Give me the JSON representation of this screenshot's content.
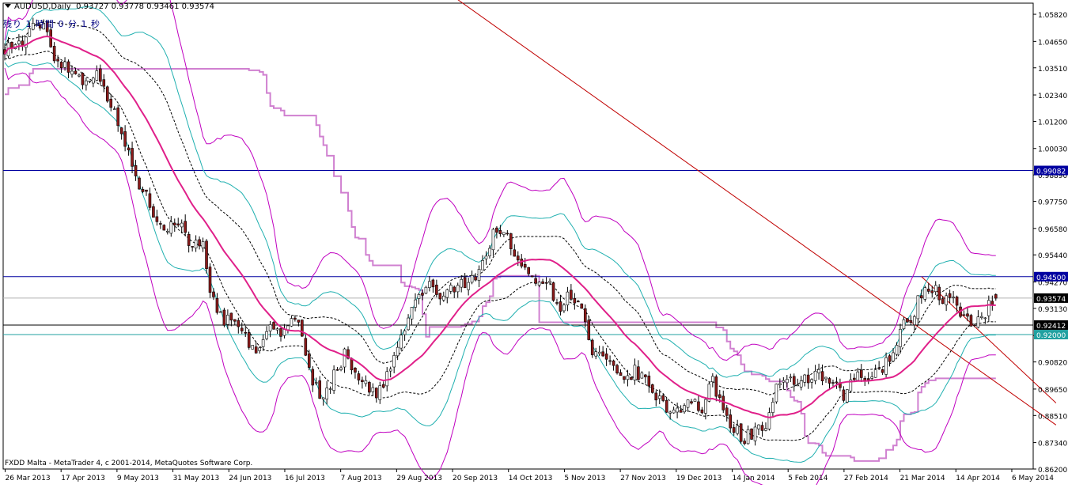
{
  "header": {
    "symbol": "AUDUSD,Daily",
    "ohlc": "0.93727 0.93778 0.93461 0.93574",
    "timer": "残り 1 時間 0 分 1 秒"
  },
  "footer": {
    "copyright": "FXDD Malta - MetaTrader 4, c 2001-2014, MetaQuotes Software Corp."
  },
  "colors": {
    "background": "#ffffff",
    "bull_candle": "#ffffff",
    "bear_candle": "#8b1a1a",
    "candle_outline": "#000000",
    "ma": "#e0208a",
    "band_outer": "#c000c0",
    "band_mid": "#20b0b0",
    "band_inner": "#000000",
    "stair": "#d080d0",
    "trendline": "#c00000",
    "hline_blue": "#0000a0",
    "hline_black": "#000000",
    "hline_teal": "#20a0a0",
    "hline_grey": "#b0b0b0"
  },
  "chart_data": {
    "type": "candlestick",
    "symbol": "AUDUSD",
    "timeframe": "Daily",
    "ylim": [
      0.862,
      1.063
    ],
    "y_ticks": [
      "1.05820",
      "1.04650",
      "1.03510",
      "1.02340",
      "1.01200",
      "1.00030",
      "0.98890",
      "0.97750",
      "0.96580",
      "0.95440",
      "0.94270",
      "0.93130",
      "0.91960",
      "0.90820",
      "0.89650",
      "0.88510",
      "0.87340",
      "0.86200"
    ],
    "x_ticks": [
      "26 Mar 2013",
      "17 Apr 2013",
      "9 May 2013",
      "31 May 2013",
      "24 Jun 2013",
      "16 Jul 2013",
      "7 Aug 2013",
      "29 Aug 2013",
      "20 Sep 2013",
      "14 Oct 2013",
      "5 Nov 2013",
      "27 Nov 2013",
      "19 Dec 2013",
      "14 Jan 2014",
      "5 Feb 2014",
      "27 Feb 2014",
      "21 Mar 2014",
      "14 Apr 2014",
      "6 May 2014"
    ],
    "price_labels": [
      {
        "value": 0.99082,
        "text": "0.99082",
        "style": "blue"
      },
      {
        "value": 0.945,
        "text": "0.94500",
        "style": "blue"
      },
      {
        "value": 0.93574,
        "text": "0.93574",
        "style": "black"
      },
      {
        "value": 0.92412,
        "text": "0.92412",
        "style": "black"
      },
      {
        "value": 0.92,
        "text": "0.92000",
        "style": "teal"
      }
    ],
    "horizontal_lines": [
      {
        "value": 0.99082,
        "style": "blue"
      },
      {
        "value": 0.945,
        "style": "blue"
      },
      {
        "value": 0.93574,
        "style": "grey"
      },
      {
        "value": 0.92412,
        "style": "black"
      },
      {
        "value": 0.92,
        "style": "teal"
      }
    ],
    "trendlines": [
      {
        "from_index": 128,
        "from_value": 1.0645,
        "to_index": 297,
        "to_value": 0.881
      },
      {
        "from_index": 259,
        "from_value": 0.945,
        "to_index": 297,
        "to_value": 0.8905
      }
    ],
    "close_anchors": [
      [
        0,
        1.044
      ],
      [
        5,
        1.046
      ],
      [
        8,
        1.052
      ],
      [
        11,
        1.055
      ],
      [
        14,
        1.04
      ],
      [
        18,
        1.035
      ],
      [
        22,
        1.03
      ],
      [
        25,
        1.033
      ],
      [
        28,
        1.028
      ],
      [
        33,
        1.006
      ],
      [
        38,
        0.985
      ],
      [
        42,
        0.973
      ],
      [
        46,
        0.966
      ],
      [
        50,
        0.969
      ],
      [
        53,
        0.957
      ],
      [
        56,
        0.962
      ],
      [
        58,
        0.94
      ],
      [
        60,
        0.928
      ],
      [
        64,
        0.925
      ],
      [
        68,
        0.918
      ],
      [
        72,
        0.912
      ],
      [
        75,
        0.927
      ],
      [
        78,
        0.917
      ],
      [
        81,
        0.929
      ],
      [
        84,
        0.921
      ],
      [
        87,
        0.899
      ],
      [
        90,
        0.892
      ],
      [
        93,
        0.903
      ],
      [
        96,
        0.911
      ],
      [
        99,
        0.905
      ],
      [
        102,
        0.898
      ],
      [
        105,
        0.893
      ],
      [
        108,
        0.902
      ],
      [
        112,
        0.918
      ],
      [
        116,
        0.935
      ],
      [
        120,
        0.941
      ],
      [
        124,
        0.936
      ],
      [
        128,
        0.941
      ],
      [
        133,
        0.946
      ],
      [
        136,
        0.954
      ],
      [
        139,
        0.967
      ],
      [
        142,
        0.961
      ],
      [
        146,
        0.948
      ],
      [
        150,
        0.945
      ],
      [
        153,
        0.943
      ],
      [
        157,
        0.932
      ],
      [
        160,
        0.938
      ],
      [
        163,
        0.93
      ],
      [
        166,
        0.912
      ],
      [
        170,
        0.908
      ],
      [
        174,
        0.9
      ],
      [
        178,
        0.904
      ],
      [
        182,
        0.898
      ],
      [
        186,
        0.889
      ],
      [
        190,
        0.887
      ],
      [
        193,
        0.893
      ],
      [
        197,
        0.887
      ],
      [
        200,
        0.9
      ],
      [
        203,
        0.887
      ],
      [
        206,
        0.88
      ],
      [
        209,
        0.875
      ],
      [
        212,
        0.879
      ],
      [
        215,
        0.88
      ],
      [
        218,
        0.896
      ],
      [
        222,
        0.899
      ],
      [
        226,
        0.901
      ],
      [
        230,
        0.902
      ],
      [
        234,
        0.898
      ],
      [
        237,
        0.893
      ],
      [
        241,
        0.903
      ],
      [
        244,
        0.901
      ],
      [
        247,
        0.903
      ],
      [
        250,
        0.911
      ],
      [
        253,
        0.922
      ],
      [
        256,
        0.927
      ],
      [
        259,
        0.938
      ],
      [
        262,
        0.94
      ],
      [
        265,
        0.936
      ],
      [
        268,
        0.934
      ],
      [
        271,
        0.926
      ],
      [
        274,
        0.926
      ],
      [
        277,
        0.93
      ],
      [
        280,
        0.9357
      ]
    ],
    "count": 281,
    "seed": 97
  }
}
